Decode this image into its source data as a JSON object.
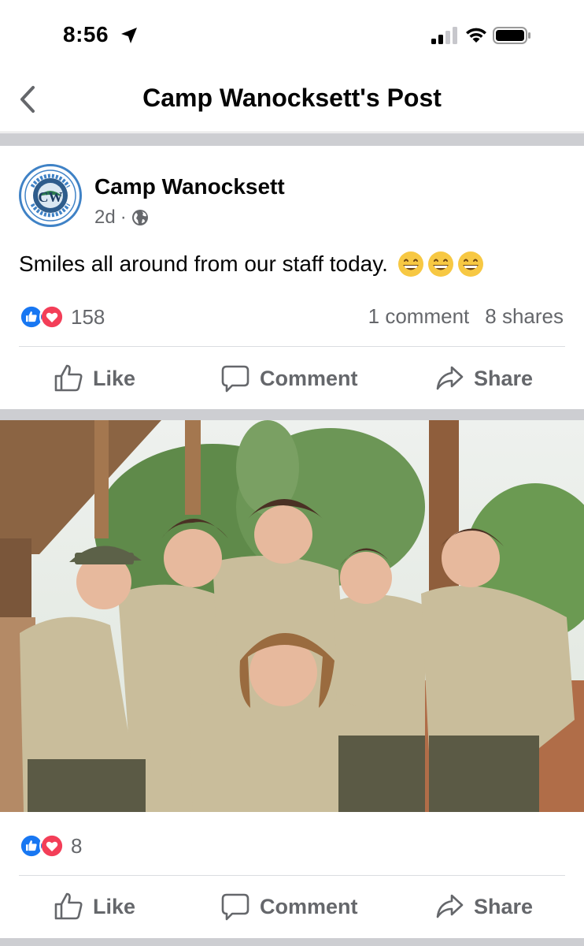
{
  "status_bar": {
    "time": "8:56",
    "icons": [
      "location-arrow-icon",
      "signal-icon",
      "wifi-icon",
      "battery-icon"
    ]
  },
  "nav": {
    "title": "Camp Wanocksett's Post",
    "back_icon": "chevron-left-icon"
  },
  "post": {
    "author": "Camp Wanocksett",
    "time_ago": "2d",
    "separator": "·",
    "privacy_icon": "globe-icon",
    "text": "Smiles all around from our staff today.",
    "emojis": [
      "grinning-face-icon",
      "grinning-face-icon",
      "grinning-face-icon"
    ],
    "reaction_count": "158",
    "comments": "1 comment",
    "shares": "8 shares"
  },
  "actions": {
    "like": "Like",
    "comment": "Comment",
    "share": "Share"
  },
  "photo": {
    "reaction_count": "8",
    "actions": {
      "like": "Like",
      "comment": "Comment",
      "share": "Share"
    }
  },
  "colors": {
    "like_blue": "#1877f2",
    "love_red": "#f33e58",
    "muted_text": "#65676b",
    "divider": "#cdced2"
  }
}
